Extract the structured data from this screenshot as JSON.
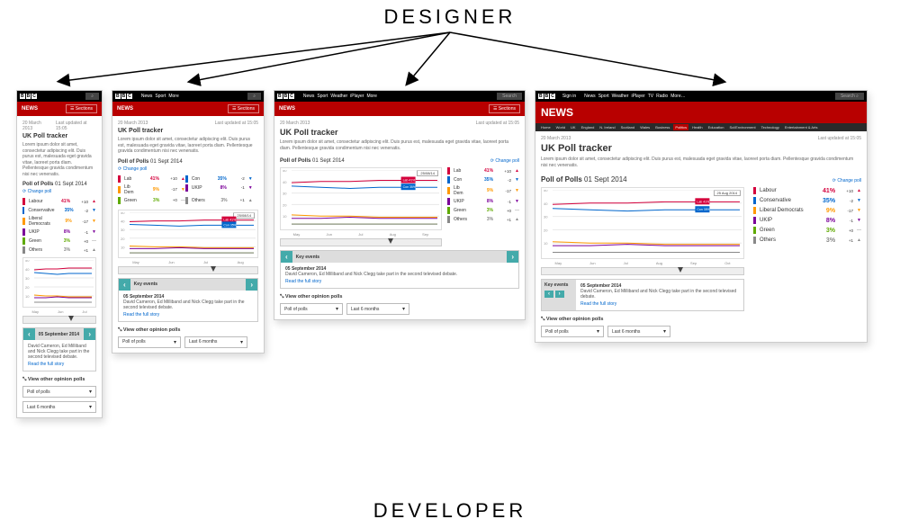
{
  "labels": {
    "designer": "DESIGNER",
    "developer": "DEVELOPER"
  },
  "header": {
    "bbc": [
      "B",
      "B",
      "C"
    ],
    "links_short": [
      "News",
      "Sport",
      "More"
    ],
    "links_mid": [
      "News",
      "Sport",
      "Weather",
      "iPlayer",
      "More"
    ],
    "links_full": [
      "News",
      "Sport",
      "Weather",
      "iPlayer",
      "TV",
      "Radio",
      "More…"
    ],
    "signin": "Sign in",
    "search_placeholder": "Search"
  },
  "newsbar": {
    "brand": "NEWS",
    "sections": "☰ Sections"
  },
  "subnav": {
    "items": [
      "Home",
      "World",
      "UK",
      "England",
      "N. Ireland",
      "Scotland",
      "Wales",
      "Business",
      "Politics",
      "Health",
      "Education",
      "Sci/Environment",
      "Technology",
      "Entertainment & Arts"
    ],
    "active_index": 8
  },
  "page": {
    "meta_date": "20 March 2013",
    "meta_updated": "Last updated at 15:05",
    "title": "UK Poll tracker",
    "lorem": "Lorem ipsum dolor sit amet, consectetur adipiscing elit. Duis purus est, malesuada eget gravida vitae, laoreet porta diam. Pellentesque gravida condimentum nisi nec venenatis.",
    "pollhead": "Poll of Polls",
    "polldate": "01 Sept 2014",
    "changepoll": "⟳ Change poll",
    "chart_date_1": "25/08/14",
    "chart_date_2": "25 Aug 2014"
  },
  "parties": [
    {
      "name": "Labour",
      "short": "Lab",
      "color": "#d4003c",
      "pct": "41%",
      "delta": "+10",
      "tri": "▲",
      "tricolor": "#d4003c"
    },
    {
      "name": "Conservative",
      "short": "Con",
      "color": "#0066cc",
      "pct": "35%",
      "delta": "-2",
      "tri": "▼",
      "tricolor": "#0066cc"
    },
    {
      "name": "Liberal Democrats",
      "short": "Lib Dem",
      "color": "#ff9900",
      "pct": "9%",
      "delta": "-17",
      "tri": "▼",
      "tricolor": "#ff9900"
    },
    {
      "name": "UKIP",
      "short": "UKIP",
      "color": "#7b0099",
      "pct": "8%",
      "delta": "-1",
      "tri": "▼",
      "tricolor": "#7b0099"
    },
    {
      "name": "Green",
      "short": "Green",
      "color": "#5faa00",
      "pct": "3%",
      "delta": "+0",
      "tri": "—",
      "tricolor": "#888"
    },
    {
      "name": "Others",
      "short": "Others",
      "color": "#888",
      "pct": "3%",
      "delta": "+1",
      "tri": "▲",
      "tricolor": "#888"
    }
  ],
  "chart_data": {
    "type": "line",
    "xlabel": "",
    "ylabel": "%",
    "ylim": [
      0,
      50
    ],
    "categories": [
      "May",
      "Jun",
      "Jul",
      "Aug",
      "Sep",
      "Oct"
    ],
    "series": [
      {
        "name": "Labour",
        "color": "#d4003c",
        "values": [
          39,
          40,
          40,
          41,
          41,
          41
        ]
      },
      {
        "name": "Conservative",
        "color": "#0066cc",
        "values": [
          36,
          35,
          34,
          35,
          35,
          35
        ]
      },
      {
        "name": "Liberal Democrats",
        "color": "#ff9900",
        "values": [
          11,
          10,
          10,
          9,
          9,
          9
        ]
      },
      {
        "name": "UKIP",
        "color": "#7b0099",
        "values": [
          8,
          8,
          9,
          8,
          8,
          8
        ]
      },
      {
        "name": "Green",
        "color": "#5faa00",
        "values": [
          3,
          3,
          3,
          3,
          3,
          3
        ]
      },
      {
        "name": "Others",
        "color": "#888",
        "values": [
          3,
          3,
          3,
          3,
          3,
          3
        ]
      }
    ]
  },
  "keyevents": {
    "heading": "Key events",
    "date": "05 September 2014",
    "text": "David Cameron, Ed Milliband and Nick Clegg take part in the second televised debate.",
    "link": "Read the full story"
  },
  "other": {
    "heading": "⤡ View other opinion polls",
    "dd1": "Poll of polls",
    "dd2": "Last 6 months"
  }
}
